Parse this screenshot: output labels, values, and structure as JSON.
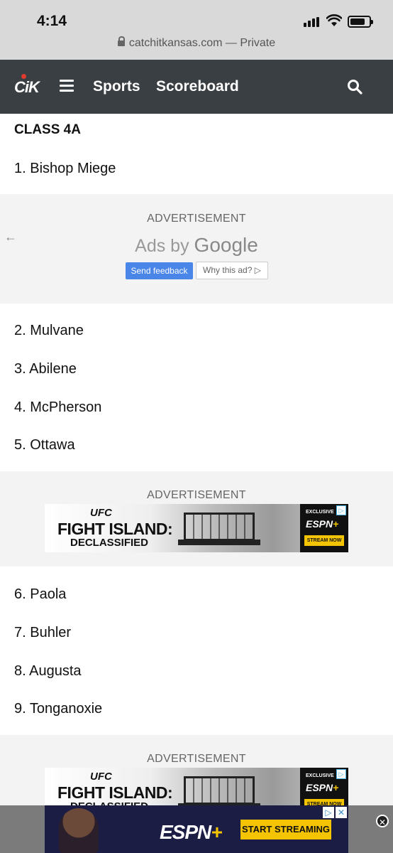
{
  "status_bar": {
    "time": "4:14",
    "url": "catchitkansas.com — Private"
  },
  "nav": {
    "logo_text": "CiK",
    "links": [
      "Sports",
      "Scoreboard"
    ]
  },
  "section": {
    "title": "CLASS 4A"
  },
  "rankings": [
    "1. Bishop Miege",
    "2. Mulvane",
    "3. Abilene",
    "4. McPherson",
    "5. Ottawa",
    "6. Paola",
    "7. Buhler",
    "8. Augusta",
    "9. Tonganoxie"
  ],
  "ads": {
    "label": "ADVERTISEMENT",
    "ads_by": "Ads by",
    "google": "Google",
    "send_feedback": "Send feedback",
    "why_this_ad": "Why this ad? ▷",
    "banner": {
      "ufc": "UFC",
      "title": "FIGHT ISLAND:",
      "subtitle": "DECLASSIFIED",
      "exclusive": "EXCLUSIVE",
      "espn": "ESPN",
      "plus": "+",
      "stream_now": "STREAM NOW"
    },
    "sticky": {
      "espn": "ESPN",
      "plus": "+",
      "cta": "START STREAMING"
    }
  },
  "colors": {
    "nav_bg": "#3a3f44",
    "logo_accent": "#e03a2f",
    "feedback_blue": "#4a86e8",
    "espn_yellow": "#f5c400"
  }
}
